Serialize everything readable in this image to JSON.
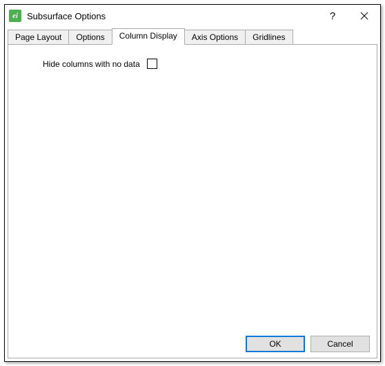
{
  "window": {
    "title": "Subsurface Options",
    "icon_letter": "ei"
  },
  "tabs": [
    {
      "label": "Page Layout",
      "active": false
    },
    {
      "label": "Options",
      "active": false
    },
    {
      "label": "Column Display",
      "active": true
    },
    {
      "label": "Axis Options",
      "active": false
    },
    {
      "label": "Gridlines",
      "active": false
    }
  ],
  "content": {
    "hide_columns_label": "Hide columns with no data",
    "hide_columns_checked": false
  },
  "buttons": {
    "ok": "OK",
    "cancel": "Cancel"
  }
}
